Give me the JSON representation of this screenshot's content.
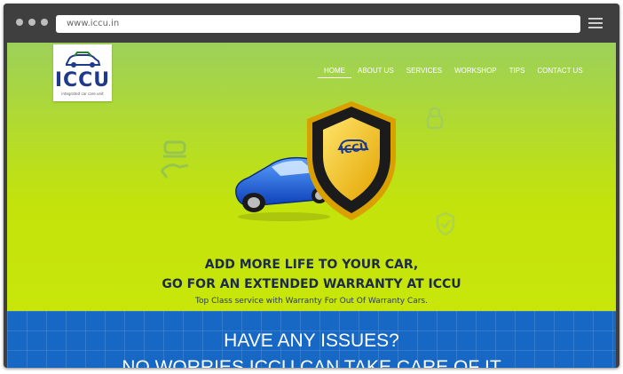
{
  "browser": {
    "url": "www.iccu.in"
  },
  "logo": {
    "text": "ICCU",
    "tagline": "integrated car care unit"
  },
  "nav": {
    "items": [
      {
        "label": "HOME"
      },
      {
        "label": "ABOUT US"
      },
      {
        "label": "SERVICES"
      },
      {
        "label": "WORKSHOP"
      },
      {
        "label": "TIPS"
      },
      {
        "label": "CONTACT US"
      }
    ]
  },
  "hero": {
    "shield_text": "ICCU",
    "headline_line1": "ADD MORE LIFE TO YOUR CAR,",
    "headline_line2": "GO FOR AN EXTENDED WARRANTY AT ICCU",
    "subline": "Top Class service with Warranty For Out Of Warranty Cars."
  },
  "issues": {
    "title": "HAVE ANY ISSUES?",
    "subtitle": "NO WORRIES ICCU CAN TAKE CARE OF IT"
  },
  "colors": {
    "hero_green": "#c3e30c",
    "issues_blue": "#1668c4",
    "brand_navy": "#1e3a8a"
  }
}
